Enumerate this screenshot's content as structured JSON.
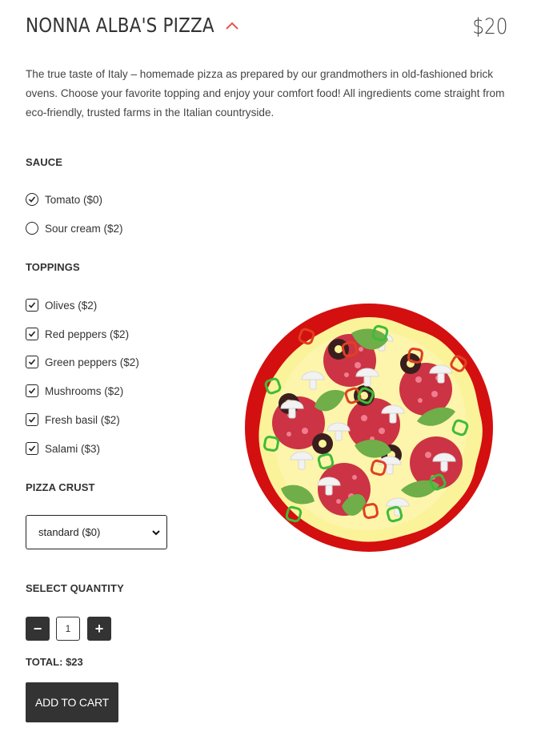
{
  "product": {
    "title": "NONNA ALBA'S PIZZA",
    "price": "$20",
    "description": "The true taste of Italy – homemade pizza as prepared by our grandmothers in old-fashioned brick ovens. Choose your favorite topping and enjoy your comfort food! All ingredients come straight from eco-friendly, trusted farms in the Italian countryside."
  },
  "sauce": {
    "label": "SAUCE",
    "options": [
      {
        "label": "Tomato ($0)",
        "selected": true
      },
      {
        "label": "Sour cream ($2)",
        "selected": false
      }
    ]
  },
  "toppings": {
    "label": "TOPPINGS",
    "options": [
      {
        "label": "Olives ($2)",
        "checked": true
      },
      {
        "label": "Red peppers ($2)",
        "checked": true
      },
      {
        "label": "Green peppers ($2)",
        "checked": true
      },
      {
        "label": "Mushrooms ($2)",
        "checked": true
      },
      {
        "label": "Fresh basil ($2)",
        "checked": true
      },
      {
        "label": "Salami ($3)",
        "checked": true
      }
    ]
  },
  "crust": {
    "label": "PIZZA CRUST",
    "selected": "standard ($0)"
  },
  "quantity": {
    "label": "SELECT QUANTITY",
    "value": "1",
    "minus": "−",
    "plus": "+"
  },
  "total": "TOTAL: $23",
  "cart_button": "ADD TO CART",
  "colors": {
    "accent": "#e8554e",
    "dark": "#333333",
    "crust": "#d40f0f",
    "cheese": "#fbf39a",
    "salami": "#cc3344",
    "basil": "#6fae48"
  },
  "icons": {
    "collapse": "chevron-up-icon",
    "dropdown": "chevron-down-icon"
  }
}
